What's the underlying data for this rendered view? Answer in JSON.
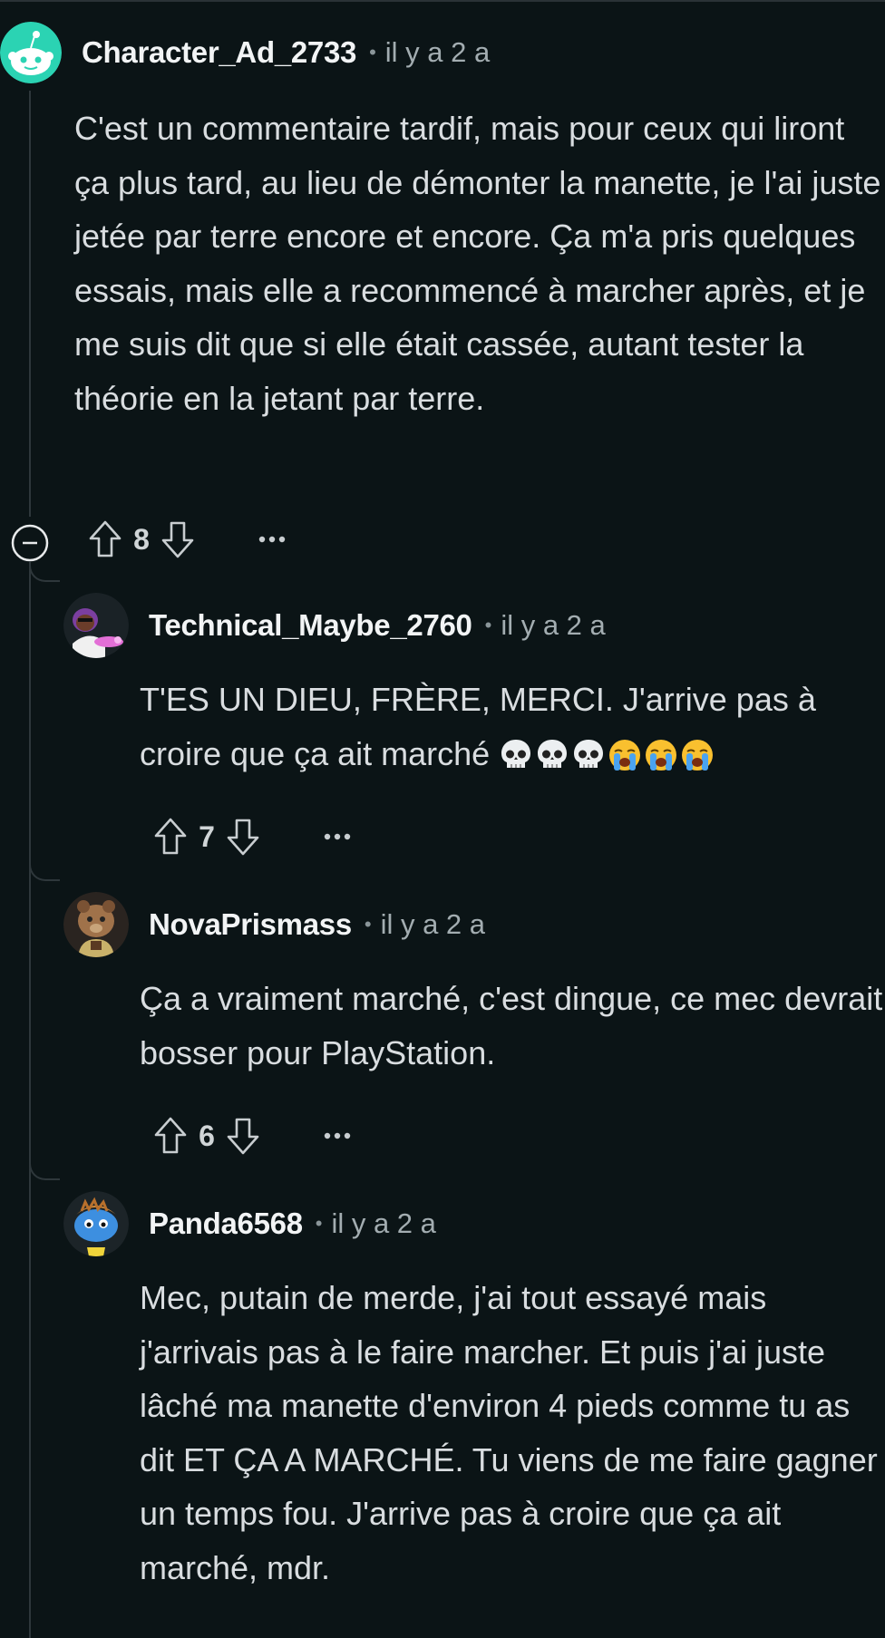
{
  "comments": [
    {
      "username": "Character_Ad_2733",
      "separator": "•",
      "time": "il y a 2 a",
      "body": "C'est un commentaire tardif, mais pour ceux qui liront ça plus tard, au lieu de démonter la manette, je l'ai juste jetée par terre encore et encore. Ça m'a pris quelques essais, mais elle a recommencé à marcher après, et je me suis dit que si elle était cassée, autant tester la théorie en la jetant par terre.",
      "score": "8",
      "more": "•••"
    },
    {
      "username": "Technical_Maybe_2760",
      "separator": "•",
      "time": "il y a 2 a",
      "body": "T'ES UN DIEU, FRÈRE, MERCI. J'arrive pas à croire que ça ait marché",
      "emojis": [
        "skull",
        "skull",
        "skull",
        "loudly-crying",
        "loudly-crying",
        "loudly-crying"
      ],
      "score": "7",
      "more": "•••"
    },
    {
      "username": "NovaPrismass",
      "separator": "•",
      "time": "il y a 2 a",
      "body": "Ça a vraiment marché, c'est dingue, ce mec devrait bosser pour PlayStation.",
      "score": "6",
      "more": "•••"
    },
    {
      "username": "Panda6568",
      "separator": "•",
      "time": "il y a 2 a",
      "body": "Mec, putain de merde, j'ai tout essayé mais j'arrivais pas à le faire marcher. Et puis j'ai juste lâché ma manette d'environ 4 pieds comme tu as dit ET ÇA A MARCHÉ. Tu viens de me faire gagner un temps fou. J'arrive pas à croire que ça ait marché, mdr."
    }
  ],
  "colors": {
    "background": "#0b1416",
    "avatar_op": "#2bd3b3",
    "thread_line": "#2e373b"
  }
}
